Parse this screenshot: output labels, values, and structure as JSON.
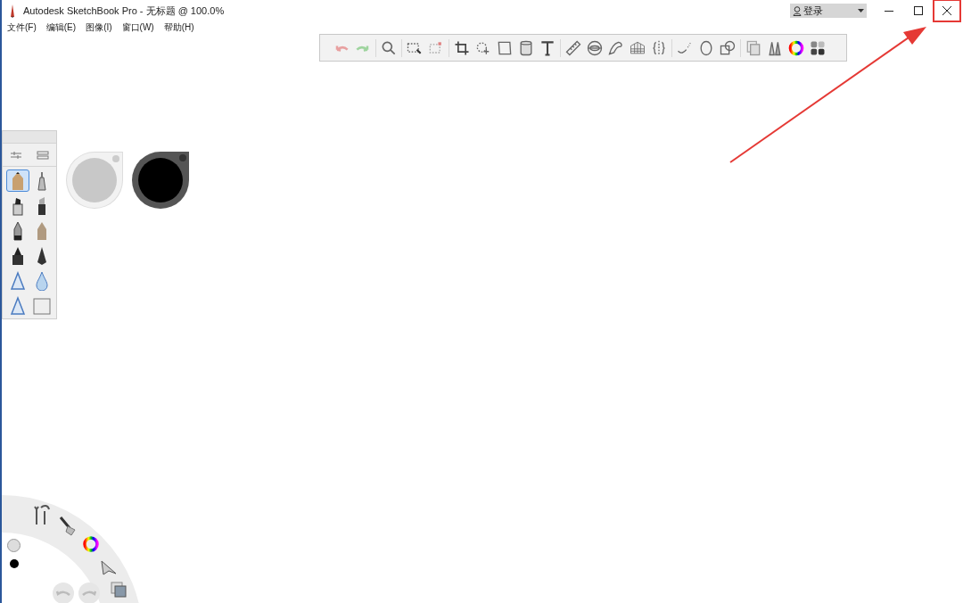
{
  "window": {
    "title": "Autodesk SketchBook Pro - 无标题 @ 100.0%"
  },
  "menu": [
    "文件(F)",
    "编辑(E)",
    "图像(I)",
    "窗口(W)",
    "帮助(H)"
  ],
  "account": {
    "label": "登录"
  },
  "toolbar": {
    "groups": [
      {
        "tools": [
          {
            "kind": "undo"
          },
          {
            "kind": "redo"
          }
        ]
      },
      {
        "tools": [
          {
            "kind": "zoom"
          }
        ]
      },
      {
        "tools": [
          {
            "kind": "select"
          },
          {
            "kind": "select-clear"
          }
        ]
      },
      {
        "tools": [
          {
            "kind": "crop"
          },
          {
            "kind": "transform"
          },
          {
            "kind": "distort"
          },
          {
            "kind": "fill"
          },
          {
            "kind": "text"
          }
        ]
      },
      {
        "tools": [
          {
            "kind": "ruler"
          },
          {
            "kind": "ellipse-guide"
          },
          {
            "kind": "french-curve"
          },
          {
            "kind": "perspective"
          },
          {
            "kind": "symmetry"
          }
        ]
      },
      {
        "tools": [
          {
            "kind": "stroke"
          },
          {
            "kind": "circle"
          },
          {
            "kind": "shapes"
          }
        ]
      },
      {
        "tools": [
          {
            "kind": "layers"
          },
          {
            "kind": "brushes"
          },
          {
            "kind": "color-wheel"
          },
          {
            "kind": "swatches"
          }
        ]
      }
    ]
  },
  "brushes": [
    {
      "kind": "pencil",
      "selected": true
    },
    {
      "kind": "airbrush",
      "selected": false
    },
    {
      "kind": "marker",
      "selected": false
    },
    {
      "kind": "chisel",
      "selected": false
    },
    {
      "kind": "pen",
      "selected": false
    },
    {
      "kind": "paintbrush",
      "selected": false
    },
    {
      "kind": "inker",
      "selected": false
    },
    {
      "kind": "nib",
      "selected": false
    },
    {
      "kind": "smudge",
      "selected": false
    },
    {
      "kind": "blur",
      "selected": false
    },
    {
      "kind": "smudge",
      "selected": false
    },
    {
      "kind": "eraser",
      "selected": false
    }
  ],
  "pucks": [
    {
      "color": "#c8c8c8"
    },
    {
      "color": "#000000"
    }
  ]
}
